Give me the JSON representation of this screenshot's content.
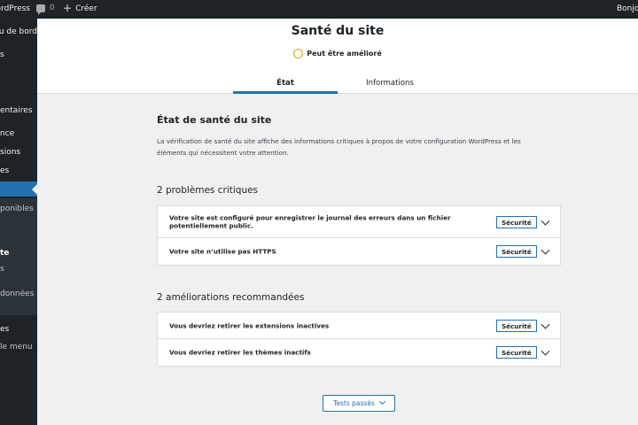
{
  "admin_bar": {
    "site_name": "WordPress",
    "comments_count": "0",
    "create_label": "Créer",
    "greeting": "Bonjour"
  },
  "sidebar": {
    "items": [
      {
        "label": "u de bord"
      },
      {
        "label": "s"
      },
      {
        "label": "entaires"
      },
      {
        "label": "nce"
      },
      {
        "label": "sions"
      },
      {
        "label": "es"
      },
      {
        "label": "ponibles"
      },
      {
        "label": "te"
      },
      {
        "label": "s"
      },
      {
        "label": "données"
      },
      {
        "label": "es"
      },
      {
        "label": "le menu"
      }
    ]
  },
  "header": {
    "title": "Santé du site",
    "status": "Peut être amélioré",
    "status_color": "#dba617",
    "tabs": [
      {
        "label": "État"
      },
      {
        "label": "Informations"
      }
    ]
  },
  "main": {
    "heading": "État de santé du site",
    "description": "La vérification de santé du site affiche des informations critiques à propos de votre configuration WordPress et les éléments qui nécessitent votre attention.",
    "critical": {
      "title": "2 problèmes critiques",
      "items": [
        {
          "label": "Votre site est configuré pour enregistrer le journal des erreurs dans un fichier potentiellement public.",
          "badge": "Sécurité"
        },
        {
          "label": "Votre site n’utilise pas HTTPS",
          "badge": "Sécurité"
        }
      ]
    },
    "recommended": {
      "title": "2 améliorations recommandées",
      "items": [
        {
          "label": "Vous devriez retirer les extensions inactives",
          "badge": "Sécurité"
        },
        {
          "label": "Vous devriez retirer les thèmes inactifs",
          "badge": "Sécurité"
        }
      ]
    },
    "passed_button": "Tests passés"
  },
  "colors": {
    "accent": "#2271b1",
    "admin_dark": "#1d2327",
    "background": "#f0f0f1"
  }
}
